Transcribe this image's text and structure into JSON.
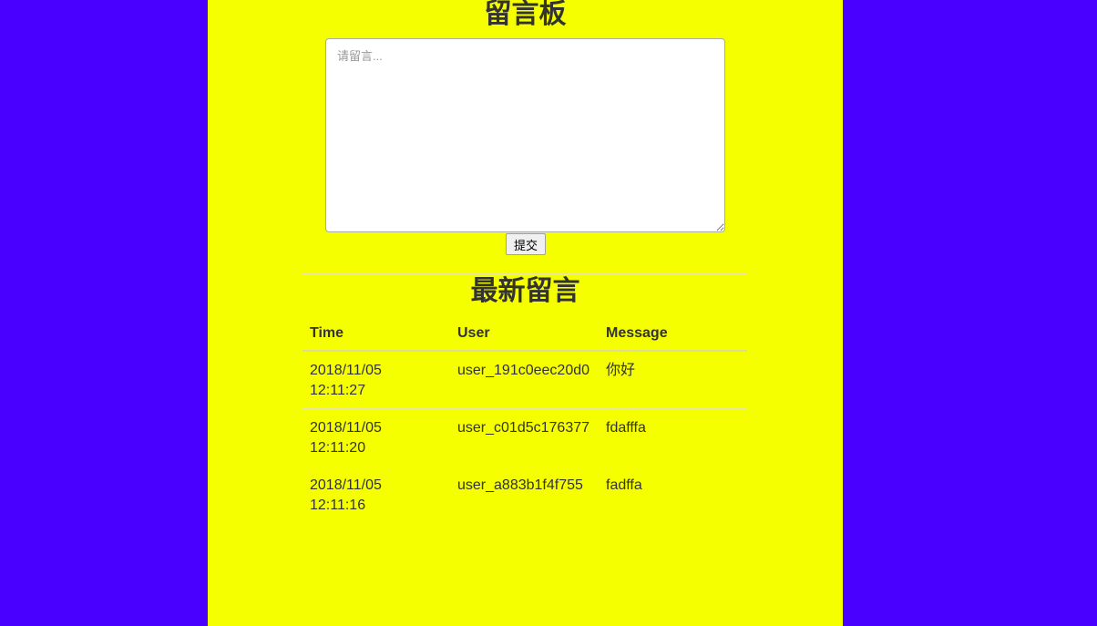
{
  "board": {
    "title": "留言板",
    "input_placeholder": "请留言...",
    "input_value": "",
    "submit_label": "提交"
  },
  "latest": {
    "title": "最新留言",
    "columns": [
      "Time",
      "User",
      "Message"
    ],
    "rows": [
      {
        "time_date": "2018/11/05",
        "time_clock": "12:11:27",
        "user": "user_191c0eec20d0",
        "message": "你好"
      },
      {
        "time_date": "2018/11/05",
        "time_clock": "12:11:20",
        "user": "user_c01d5c176377",
        "message": "fdafffa"
      },
      {
        "time_date": "2018/11/05",
        "time_clock": "12:11:16",
        "user": "user_a883b1f4f755",
        "message": "fadffa"
      }
    ]
  },
  "colors": {
    "page_background": "#4a00ff",
    "content_background": "#f5ff00",
    "text": "#333333"
  }
}
